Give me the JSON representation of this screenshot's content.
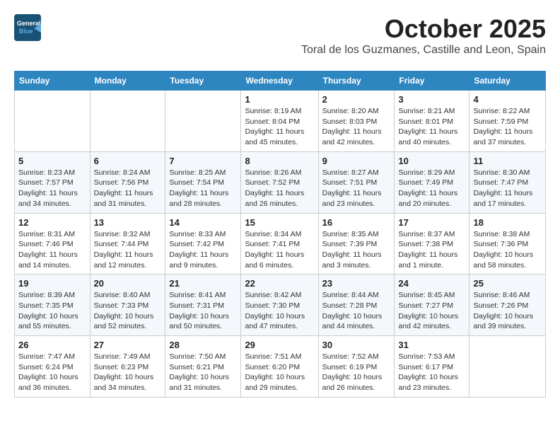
{
  "header": {
    "logo_line1": "General",
    "logo_line2": "Blue",
    "month_title": "October 2025",
    "location": "Toral de los Guzmanes, Castille and Leon, Spain"
  },
  "weekdays": [
    "Sunday",
    "Monday",
    "Tuesday",
    "Wednesday",
    "Thursday",
    "Friday",
    "Saturday"
  ],
  "weeks": [
    [
      {
        "day": "",
        "info": ""
      },
      {
        "day": "",
        "info": ""
      },
      {
        "day": "",
        "info": ""
      },
      {
        "day": "1",
        "info": "Sunrise: 8:19 AM\nSunset: 8:04 PM\nDaylight: 11 hours and 45 minutes."
      },
      {
        "day": "2",
        "info": "Sunrise: 8:20 AM\nSunset: 8:03 PM\nDaylight: 11 hours and 42 minutes."
      },
      {
        "day": "3",
        "info": "Sunrise: 8:21 AM\nSunset: 8:01 PM\nDaylight: 11 hours and 40 minutes."
      },
      {
        "day": "4",
        "info": "Sunrise: 8:22 AM\nSunset: 7:59 PM\nDaylight: 11 hours and 37 minutes."
      }
    ],
    [
      {
        "day": "5",
        "info": "Sunrise: 8:23 AM\nSunset: 7:57 PM\nDaylight: 11 hours and 34 minutes."
      },
      {
        "day": "6",
        "info": "Sunrise: 8:24 AM\nSunset: 7:56 PM\nDaylight: 11 hours and 31 minutes."
      },
      {
        "day": "7",
        "info": "Sunrise: 8:25 AM\nSunset: 7:54 PM\nDaylight: 11 hours and 28 minutes."
      },
      {
        "day": "8",
        "info": "Sunrise: 8:26 AM\nSunset: 7:52 PM\nDaylight: 11 hours and 26 minutes."
      },
      {
        "day": "9",
        "info": "Sunrise: 8:27 AM\nSunset: 7:51 PM\nDaylight: 11 hours and 23 minutes."
      },
      {
        "day": "10",
        "info": "Sunrise: 8:29 AM\nSunset: 7:49 PM\nDaylight: 11 hours and 20 minutes."
      },
      {
        "day": "11",
        "info": "Sunrise: 8:30 AM\nSunset: 7:47 PM\nDaylight: 11 hours and 17 minutes."
      }
    ],
    [
      {
        "day": "12",
        "info": "Sunrise: 8:31 AM\nSunset: 7:46 PM\nDaylight: 11 hours and 14 minutes."
      },
      {
        "day": "13",
        "info": "Sunrise: 8:32 AM\nSunset: 7:44 PM\nDaylight: 11 hours and 12 minutes."
      },
      {
        "day": "14",
        "info": "Sunrise: 8:33 AM\nSunset: 7:42 PM\nDaylight: 11 hours and 9 minutes."
      },
      {
        "day": "15",
        "info": "Sunrise: 8:34 AM\nSunset: 7:41 PM\nDaylight: 11 hours and 6 minutes."
      },
      {
        "day": "16",
        "info": "Sunrise: 8:35 AM\nSunset: 7:39 PM\nDaylight: 11 hours and 3 minutes."
      },
      {
        "day": "17",
        "info": "Sunrise: 8:37 AM\nSunset: 7:38 PM\nDaylight: 11 hours and 1 minute."
      },
      {
        "day": "18",
        "info": "Sunrise: 8:38 AM\nSunset: 7:36 PM\nDaylight: 10 hours and 58 minutes."
      }
    ],
    [
      {
        "day": "19",
        "info": "Sunrise: 8:39 AM\nSunset: 7:35 PM\nDaylight: 10 hours and 55 minutes."
      },
      {
        "day": "20",
        "info": "Sunrise: 8:40 AM\nSunset: 7:33 PM\nDaylight: 10 hours and 52 minutes."
      },
      {
        "day": "21",
        "info": "Sunrise: 8:41 AM\nSunset: 7:31 PM\nDaylight: 10 hours and 50 minutes."
      },
      {
        "day": "22",
        "info": "Sunrise: 8:42 AM\nSunset: 7:30 PM\nDaylight: 10 hours and 47 minutes."
      },
      {
        "day": "23",
        "info": "Sunrise: 8:44 AM\nSunset: 7:28 PM\nDaylight: 10 hours and 44 minutes."
      },
      {
        "day": "24",
        "info": "Sunrise: 8:45 AM\nSunset: 7:27 PM\nDaylight: 10 hours and 42 minutes."
      },
      {
        "day": "25",
        "info": "Sunrise: 8:46 AM\nSunset: 7:26 PM\nDaylight: 10 hours and 39 minutes."
      }
    ],
    [
      {
        "day": "26",
        "info": "Sunrise: 7:47 AM\nSunset: 6:24 PM\nDaylight: 10 hours and 36 minutes."
      },
      {
        "day": "27",
        "info": "Sunrise: 7:49 AM\nSunset: 6:23 PM\nDaylight: 10 hours and 34 minutes."
      },
      {
        "day": "28",
        "info": "Sunrise: 7:50 AM\nSunset: 6:21 PM\nDaylight: 10 hours and 31 minutes."
      },
      {
        "day": "29",
        "info": "Sunrise: 7:51 AM\nSunset: 6:20 PM\nDaylight: 10 hours and 29 minutes."
      },
      {
        "day": "30",
        "info": "Sunrise: 7:52 AM\nSunset: 6:19 PM\nDaylight: 10 hours and 26 minutes."
      },
      {
        "day": "31",
        "info": "Sunrise: 7:53 AM\nSunset: 6:17 PM\nDaylight: 10 hours and 23 minutes."
      },
      {
        "day": "",
        "info": ""
      }
    ]
  ]
}
